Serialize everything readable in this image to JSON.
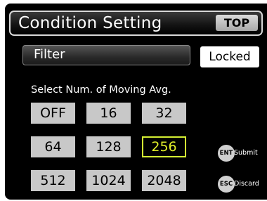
{
  "header": {
    "title": "Condition Setting",
    "top_button": "TOP"
  },
  "filter": {
    "label": "Filter",
    "status": "Locked"
  },
  "prompt": "Select Num. of Moving Avg.",
  "options": [
    "OFF",
    "16",
    "32",
    "64",
    "128",
    "256",
    "512",
    "1024",
    "2048"
  ],
  "selected_option": "256",
  "keys": {
    "enter": {
      "key": "ENT",
      "label": "Submit"
    },
    "escape": {
      "key": "ESC",
      "label": "Discard"
    }
  },
  "colors": {
    "screen_background": "#000000",
    "button_gray": "#c8c8c8",
    "selection_highlight": "#d4ee33"
  }
}
